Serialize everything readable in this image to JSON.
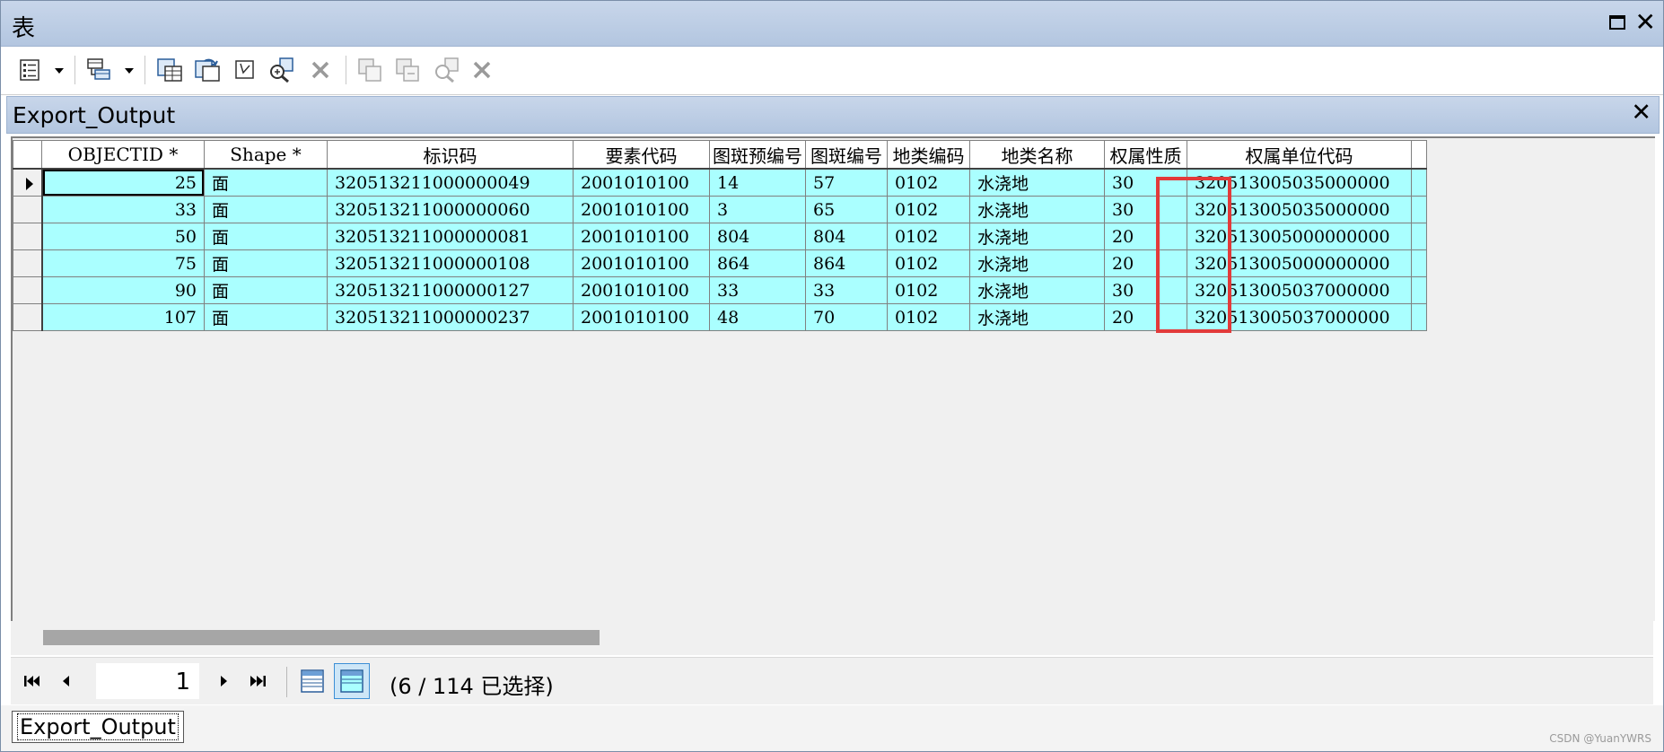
{
  "window": {
    "title": "表"
  },
  "table_panel": {
    "title": "Export_Output"
  },
  "grid": {
    "columns": [
      "OBJECTID *",
      "Shape *",
      "标识码",
      "要素代码",
      "图斑预编号",
      "图斑编号",
      "地类编码",
      "地类名称",
      "权属性质",
      "权属单位代码"
    ],
    "rows": [
      [
        "25",
        "面",
        "320513211000000049",
        "2001010100",
        "14",
        "57",
        "0102",
        "水浇地",
        "30",
        "320513005035000000"
      ],
      [
        "33",
        "面",
        "320513211000000060",
        "2001010100",
        "3",
        "65",
        "0102",
        "水浇地",
        "30",
        "320513005035000000"
      ],
      [
        "50",
        "面",
        "320513211000000081",
        "2001010100",
        "804",
        "804",
        "0102",
        "水浇地",
        "20",
        "320513005000000000"
      ],
      [
        "75",
        "面",
        "320513211000000108",
        "2001010100",
        "864",
        "864",
        "0102",
        "水浇地",
        "20",
        "320513005000000000"
      ],
      [
        "90",
        "面",
        "320513211000000127",
        "2001010100",
        "33",
        "33",
        "0102",
        "水浇地",
        "30",
        "320513005037000000"
      ],
      [
        "107",
        "面",
        "320513211000000237",
        "2001010100",
        "48",
        "70",
        "0102",
        "水浇地",
        "20",
        "320513005037000000"
      ]
    ]
  },
  "navigator": {
    "current_record": "1",
    "selection_status": "(6 / 114 已选择)"
  },
  "tabs": [
    "Export_Output"
  ],
  "watermark": "CSDN @YuanYWRS",
  "colors": {
    "selected_row": "#aaffff",
    "highlight_box": "#e23a3a",
    "title_bar": "#b3c6e0"
  }
}
